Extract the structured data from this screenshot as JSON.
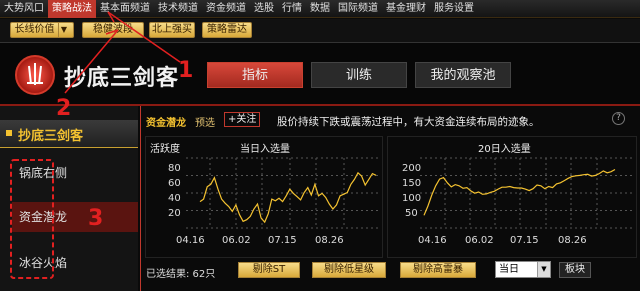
{
  "topnav": [
    "大势风口",
    "策略战法",
    "基本面频道",
    "技术频道",
    "资金频道",
    "选股",
    "行情",
    "数据",
    "国际频道",
    "基金理财",
    "服务设置"
  ],
  "subnav": {
    "b1": "长线价值",
    "b2": "稳健波段",
    "b3": "北上强买",
    "b4": "策略雷达"
  },
  "brand": "抄底三剑客",
  "tabs": [
    "指标",
    "训练",
    "我的观察池"
  ],
  "sidebar": {
    "title": "抄底三剑客",
    "items": [
      "锅底右侧",
      "资金潜龙",
      "冰谷火焰"
    ]
  },
  "info": {
    "name": "资金潜龙",
    "select": "预选",
    "follow": "+关注",
    "desc": "股价持续下跌或震荡过程中，有大资金连续布局的迹象。",
    "help": "?"
  },
  "chart1": {
    "label": "活跃度",
    "title": "当日入选量",
    "yticks": [
      "80",
      "60",
      "40",
      "20"
    ],
    "xticks": [
      "04.16",
      "06.02",
      "07.15",
      "08.26"
    ]
  },
  "chart2": {
    "title": "20日入选量",
    "yticks": [
      "200",
      "150",
      "100",
      "50"
    ],
    "xticks": [
      "04.16",
      "06.02",
      "07.15",
      "08.26"
    ]
  },
  "chart_data": [
    {
      "type": "line",
      "title": "当日入选量",
      "ylabel": "活跃度",
      "ylim": [
        0,
        90
      ],
      "xticks": [
        "04.16",
        "06.02",
        "07.15",
        "08.26"
      ],
      "series": [
        {
          "values": [
            37,
            40,
            55,
            58,
            66,
            52,
            40,
            35,
            31,
            25,
            33,
            21,
            13,
            15,
            19,
            28,
            34,
            17,
            12,
            22,
            40,
            38,
            41,
            37,
            44,
            52,
            47,
            43,
            39,
            48,
            54,
            45,
            58,
            44,
            47,
            42,
            34,
            28,
            33,
            44,
            46,
            48,
            58,
            64,
            72,
            68,
            57,
            64,
            71,
            69
          ]
        }
      ]
    },
    {
      "type": "line",
      "title": "20日入选量",
      "ylim": [
        25,
        225
      ],
      "xticks": [
        "04.16",
        "06.02",
        "07.15",
        "08.26"
      ],
      "series": [
        {
          "values": [
            70,
            95,
            125,
            150,
            168,
            172,
            158,
            147,
            153,
            150,
            143,
            145,
            136,
            130,
            133,
            127,
            128,
            132,
            135,
            141,
            146,
            146,
            148,
            145,
            144,
            144,
            141,
            137,
            142,
            152,
            150,
            142,
            148,
            145,
            155,
            158,
            164,
            170,
            175,
            177,
            178,
            180,
            181,
            176,
            178,
            183,
            190,
            185,
            188,
            194
          ]
        }
      ]
    }
  ],
  "bottom": {
    "count": "已选结果: 62只",
    "btn1": "剔除ST",
    "btn2": "剔除低星级",
    "btn3": "剔除高雷暴",
    "date": "当日",
    "plate": "板块"
  },
  "annotations": [
    "1",
    "2",
    "3"
  ],
  "colors": {
    "accent": "#c0382d",
    "gold": "#f4c230",
    "line": "#f4c230",
    "annotation": "#e22020"
  }
}
